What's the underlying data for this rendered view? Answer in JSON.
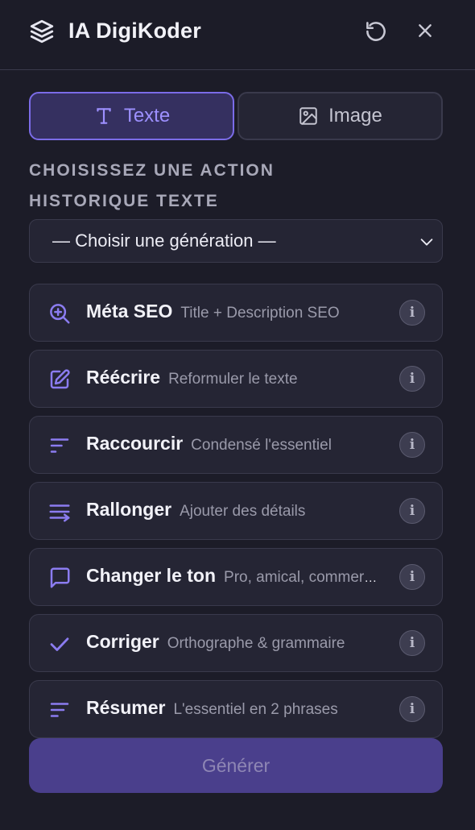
{
  "header": {
    "title": "IA DigiKoder",
    "logo_icon": "layers-icon",
    "refresh_icon": "refresh-icon",
    "close_icon": "close-icon"
  },
  "tabs": [
    {
      "label": "Texte",
      "icon": "text-type-icon",
      "active": true
    },
    {
      "label": "Image",
      "icon": "image-icon",
      "active": false
    }
  ],
  "sections": {
    "action_label": "CHOISISSEZ UNE ACTION",
    "history_label": "HISTORIQUE TEXTE"
  },
  "history_select": {
    "selected": "— Choisir une génération —"
  },
  "actions": [
    {
      "title": "Méta SEO",
      "desc": "Title + Description SEO",
      "icon": "search-zoom-icon"
    },
    {
      "title": "Réécrire",
      "desc": "Reformuler le texte",
      "icon": "edit-icon"
    },
    {
      "title": "Raccourcir",
      "desc": "Condensé l'essentiel",
      "icon": "short-lines-icon"
    },
    {
      "title": "Rallonger",
      "desc": "Ajouter des détails",
      "icon": "wrap-lines-icon"
    },
    {
      "title": "Changer le ton",
      "desc": "Pro, amical, commercial…",
      "icon": "chat-bubble-icon"
    },
    {
      "title": "Corriger",
      "desc": "Orthographe & grammaire",
      "icon": "check-icon"
    },
    {
      "title": "Résumer",
      "desc": "L'essentiel en 2 phrases",
      "icon": "summary-lines-icon"
    }
  ],
  "info_symbol": "i",
  "generate_label": "Générer",
  "colors": {
    "background": "#1c1c28",
    "accent": "#7b6ce8",
    "card": "#252534",
    "button": "#4a3f8c"
  }
}
